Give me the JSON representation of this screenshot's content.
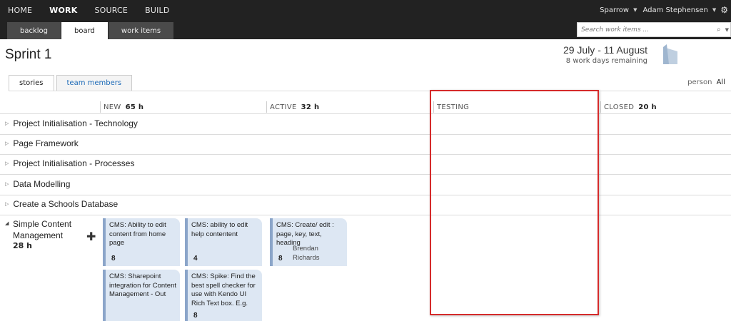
{
  "nav": {
    "items": [
      "HOME",
      "WORK",
      "SOURCE",
      "BUILD"
    ],
    "active": "WORK",
    "project": "Sparrow",
    "user": "Adam Stephensen",
    "gear_icon": "gear-icon"
  },
  "tabs": [
    "backlog",
    "board",
    "work items"
  ],
  "active_tab": "board",
  "search": {
    "placeholder": "Search work items ..."
  },
  "sprint": {
    "title": "Sprint 1",
    "dates": "29 July - 11 August",
    "remaining": "8 work days remaining"
  },
  "subtabs": [
    "stories",
    "team members"
  ],
  "person_filter": {
    "label": "person",
    "value": "All"
  },
  "columns": [
    {
      "name": "NEW",
      "hours": "65 h"
    },
    {
      "name": "ACTIVE",
      "hours": "32 h"
    },
    {
      "name": "TESTING",
      "hours": ""
    },
    {
      "name": "CLOSED",
      "hours": "20 h"
    }
  ],
  "rows": [
    "Project Initialisation - Technology",
    "Page Framework",
    "Project Initialisation - Processes",
    "Data Modelling",
    "Create a Schools Database"
  ],
  "expanded_row": {
    "title_line1": "Simple Content",
    "title_line2": "Management",
    "hours": "28 h"
  },
  "cards": [
    {
      "title": "CMS: Ability to edit content from home page",
      "points": "8",
      "assignee": ""
    },
    {
      "title": "CMS: ability to edit help contentent",
      "points": "4",
      "assignee": ""
    },
    {
      "title": "CMS: Create/ edit : page, key, text, heading",
      "points": "8",
      "assignee": "Brendan Richards"
    },
    {
      "title": "CMS: Sharepoint integration for Content Management - Out",
      "points": "",
      "assignee": ""
    },
    {
      "title": "CMS: Spike: Find the best spell checker for use with Kendo UI Rich Text box. E.g.",
      "points": "8",
      "assignee": ""
    }
  ],
  "colors": {
    "card_bg": "#dde7f3",
    "card_accent": "#8ba5c9",
    "highlight": "#d52b2b",
    "header_bg": "#222222"
  }
}
